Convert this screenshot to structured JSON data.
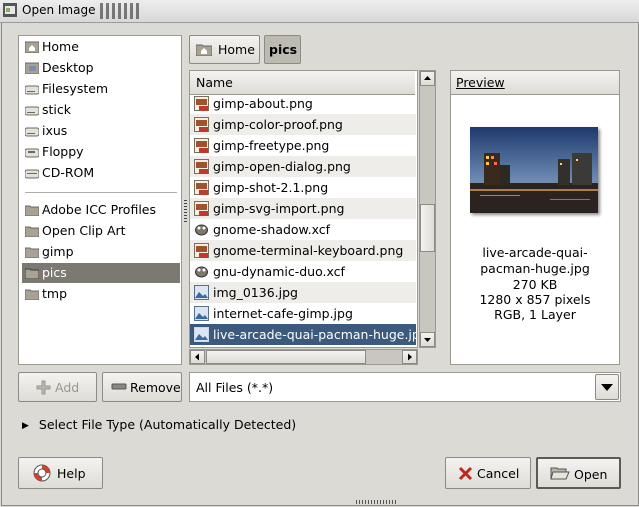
{
  "window": {
    "title": "Open Image"
  },
  "places": {
    "items": [
      {
        "label": "Home",
        "icon": "home-folder-icon"
      },
      {
        "label": "Desktop",
        "icon": "desktop-icon"
      },
      {
        "label": "Filesystem",
        "icon": "drive-icon"
      },
      {
        "label": "stick",
        "icon": "drive-icon"
      },
      {
        "label": "ixus",
        "icon": "drive-icon"
      },
      {
        "label": "Floppy",
        "icon": "floppy-icon"
      },
      {
        "label": "CD-ROM",
        "icon": "cdrom-icon"
      }
    ],
    "bookmarks": [
      {
        "label": "Adobe ICC Profiles",
        "icon": "folder-icon"
      },
      {
        "label": "Open Clip Art",
        "icon": "folder-icon"
      },
      {
        "label": "gimp",
        "icon": "folder-icon"
      },
      {
        "label": "pics",
        "icon": "folder-icon",
        "selected": true
      },
      {
        "label": "tmp",
        "icon": "folder-icon"
      }
    ]
  },
  "breadcrumb": {
    "home": "Home",
    "current": "pics"
  },
  "files": {
    "column": "Name",
    "rows": [
      {
        "name": "gimp-about.png",
        "icon": "image-file-icon"
      },
      {
        "name": "gimp-color-proof.png",
        "icon": "image-file-icon"
      },
      {
        "name": "gimp-freetype.png",
        "icon": "image-file-icon"
      },
      {
        "name": "gimp-open-dialog.png",
        "icon": "image-file-icon"
      },
      {
        "name": "gimp-shot-2.1.png",
        "icon": "image-file-icon"
      },
      {
        "name": "gimp-svg-import.png",
        "icon": "image-file-icon"
      },
      {
        "name": "gnome-shadow.xcf",
        "icon": "gimp-xcf-icon"
      },
      {
        "name": "gnome-terminal-keyboard.png",
        "icon": "image-file-icon"
      },
      {
        "name": "gnu-dynamic-duo.xcf",
        "icon": "gimp-xcf-icon"
      },
      {
        "name": "img_0136.jpg",
        "icon": "photo-file-icon"
      },
      {
        "name": "internet-cafe-gimp.jpg",
        "icon": "photo-file-icon"
      },
      {
        "name": "live-arcade-quai-pacman-huge.jpg",
        "icon": "photo-file-icon",
        "selected": true
      }
    ]
  },
  "preview": {
    "header": "Preview",
    "filename_line1": "live-arcade-quai-",
    "filename_line2": "pacman-huge.jpg",
    "size": "270 KB",
    "dimensions": "1280 x 857 pixels",
    "mode": "RGB, 1 Layer"
  },
  "buttons": {
    "add": "Add",
    "remove": "Remove",
    "help": "Help",
    "cancel": "Cancel",
    "open": "Open"
  },
  "filter": {
    "selected": "All Files (*.*)"
  },
  "filetype_expander": "Select File Type (Automatically Detected)",
  "colors": {
    "selection": "#3b5a7e",
    "place_selected": "#7c7972",
    "background": "#dcdad5"
  }
}
